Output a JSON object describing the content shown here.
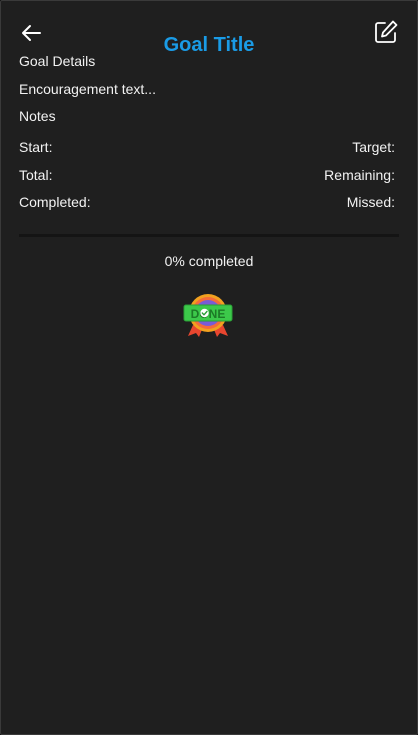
{
  "header": {
    "title": "Goal Title",
    "back_icon": "arrow-left-icon",
    "edit_icon": "edit-icon"
  },
  "goal": {
    "details_label": "Goal Details",
    "encouragement": "Encouragement text...",
    "notes_label": "Notes"
  },
  "stats": {
    "start_label": "Start:",
    "target_label": "Target:",
    "total_label": "Total:",
    "remaining_label": "Remaining:",
    "completed_label": "Completed:",
    "missed_label": "Missed:"
  },
  "progress": {
    "text": "0% completed",
    "percent": 0
  },
  "badge": {
    "icon": "done-badge-icon",
    "text": "DONE"
  },
  "colors": {
    "accent": "#1a9be6",
    "background": "#1f1f1f"
  }
}
